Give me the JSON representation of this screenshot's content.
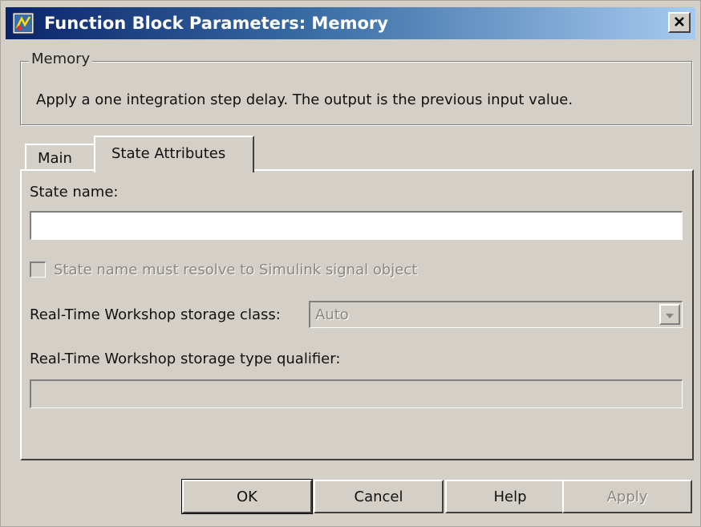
{
  "window": {
    "title": "Function Block Parameters: Memory",
    "close_glyph": "✕"
  },
  "group": {
    "label": "Memory",
    "description": "Apply a one integration step delay. The output is the previous input value."
  },
  "tabs": [
    {
      "label": "Main",
      "selected": false
    },
    {
      "label": "State Attributes",
      "selected": true
    }
  ],
  "state_attributes": {
    "state_name_label": "State name:",
    "state_name_value": "",
    "resolve_checkbox_label": "State name must resolve to Simulink signal object",
    "resolve_checked": false,
    "storage_class_label": "Real-Time Workshop storage class:",
    "storage_class_value": "Auto",
    "type_qualifier_label": "Real-Time Workshop storage type qualifier:",
    "type_qualifier_value": ""
  },
  "buttons": {
    "ok": "OK",
    "cancel": "Cancel",
    "help": "Help",
    "apply": "Apply"
  },
  "colors": {
    "dialog_bg": "#d4d0c8",
    "title_gradient_start": "#0a246a",
    "title_gradient_end": "#a6caf0",
    "disabled_text": "#8a8780"
  }
}
